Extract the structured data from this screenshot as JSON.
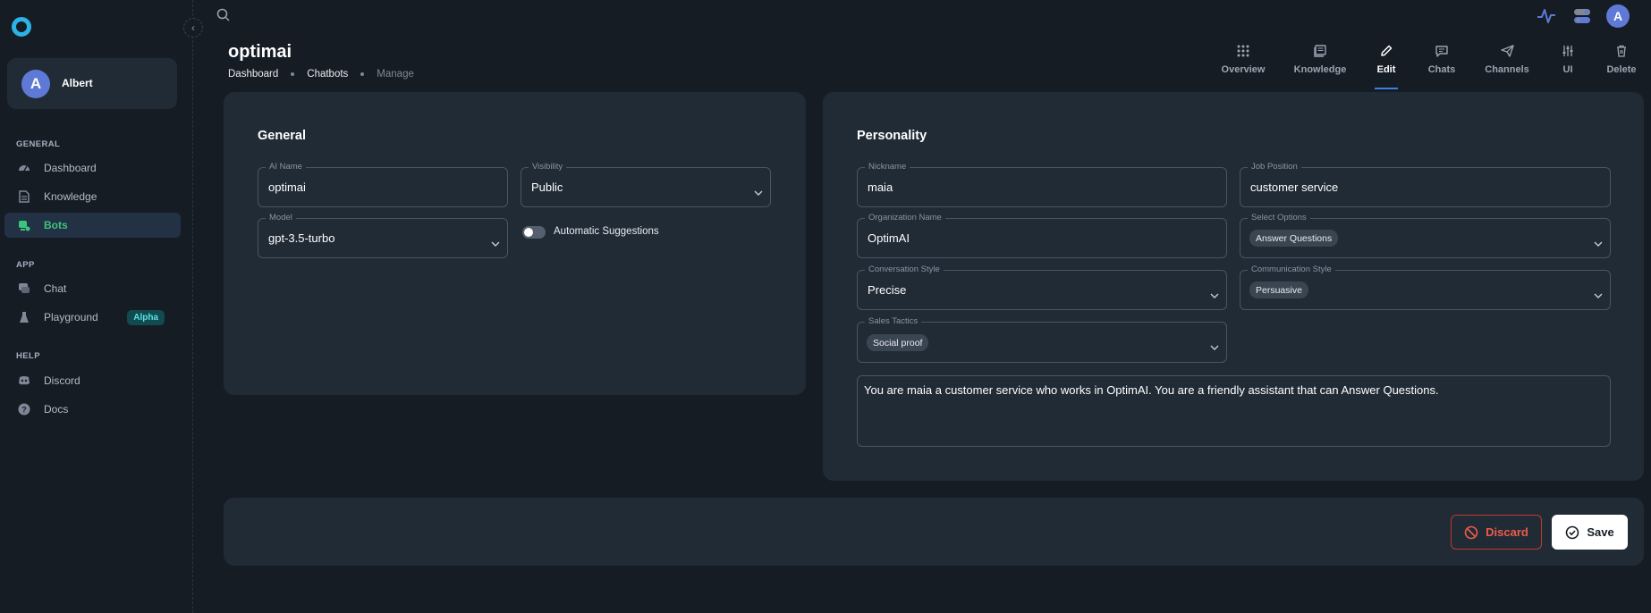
{
  "user": {
    "name": "Albert",
    "initial": "A"
  },
  "sidebar": {
    "sections": [
      {
        "label": "GENERAL"
      },
      {
        "label": "APP"
      },
      {
        "label": "HELP"
      }
    ],
    "items": [
      {
        "label": "Dashboard",
        "icon": "dashboard-icon"
      },
      {
        "label": "Knowledge",
        "icon": "document-icon"
      },
      {
        "label": "Bots",
        "icon": "bot-icon",
        "active": true
      },
      {
        "label": "Chat",
        "icon": "chat-icon"
      },
      {
        "label": "Playground",
        "icon": "flask-icon",
        "badge": "Alpha"
      },
      {
        "label": "Discord",
        "icon": "discord-icon"
      },
      {
        "label": "Docs",
        "icon": "help-icon"
      }
    ]
  },
  "header": {
    "title": "optimai",
    "breadcrumbs": [
      "Dashboard",
      "Chatbots",
      "Manage"
    ]
  },
  "tabs": [
    {
      "label": "Overview",
      "icon": "grid-icon"
    },
    {
      "label": "Knowledge",
      "icon": "book-icon"
    },
    {
      "label": "Edit",
      "icon": "pencil-icon",
      "active": true
    },
    {
      "label": "Chats",
      "icon": "message-icon"
    },
    {
      "label": "Channels",
      "icon": "send-icon"
    },
    {
      "label": "UI",
      "icon": "sliders-icon"
    },
    {
      "label": "Delete",
      "icon": "trash-icon"
    }
  ],
  "general": {
    "title": "General",
    "ai_name": {
      "label": "AI Name",
      "value": "optimai"
    },
    "visibility": {
      "label": "Visibility",
      "value": "Public"
    },
    "model": {
      "label": "Model",
      "value": "gpt-3.5-turbo"
    },
    "auto_suggestions": {
      "label": "Automatic Suggestions",
      "enabled": false
    }
  },
  "personality": {
    "title": "Personality",
    "nickname": {
      "label": "Nickname",
      "value": "maia"
    },
    "job_position": {
      "label": "Job Position",
      "value": "customer service"
    },
    "organization": {
      "label": "Organization Name",
      "value": "OptimAI"
    },
    "select_options": {
      "label": "Select Options",
      "value": "Answer Questions"
    },
    "conversation_style": {
      "label": "Conversation Style",
      "value": "Precise"
    },
    "communication_style": {
      "label": "Communication Style",
      "value": "Persuasive"
    },
    "sales_tactics": {
      "label": "Sales Tactics",
      "value": "Social proof"
    },
    "prompt": "You are maia a customer service who works in OptimAI. You are a friendly assistant that can Answer Questions."
  },
  "actions": {
    "discard": "Discard",
    "save": "Save"
  },
  "colors": {
    "background": "#161c24",
    "card": "#212b36",
    "accent_green": "#3bc47b",
    "accent_blue": "#3e7ee0",
    "danger": "#ef5b4b",
    "logo": "#2bb3e6"
  }
}
